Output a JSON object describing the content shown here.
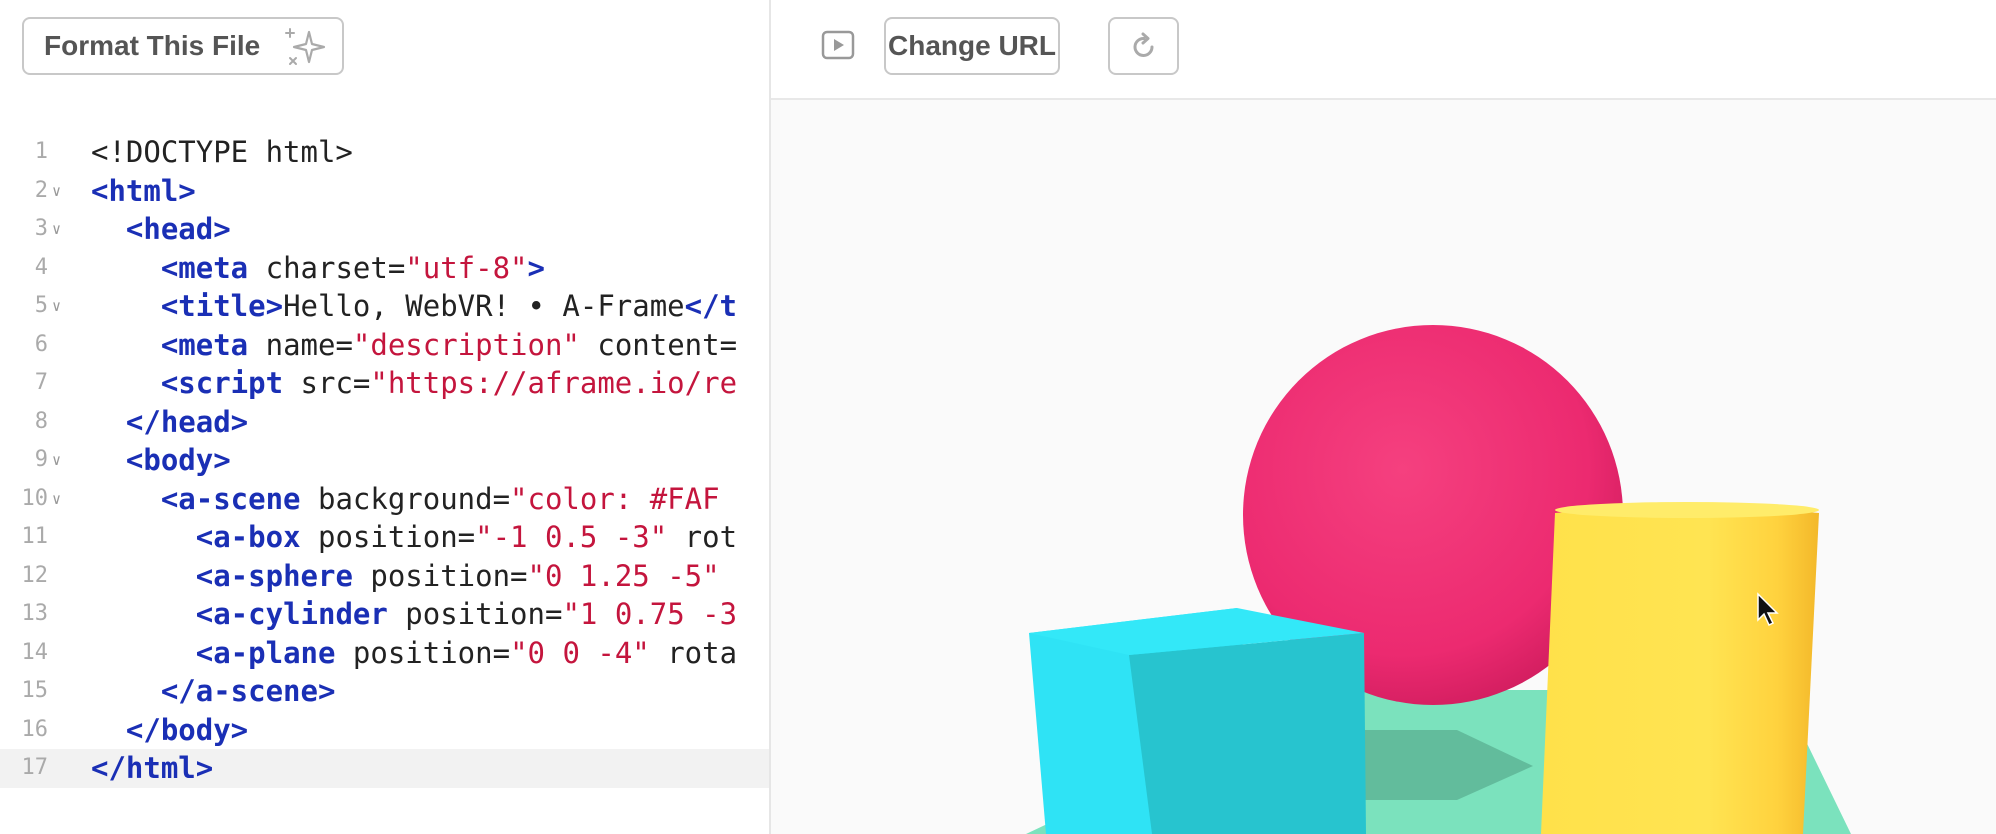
{
  "editor": {
    "format_button_label": "Format This File",
    "sparkle_icon": "sparkle-icon",
    "current_line": 17,
    "lines": [
      {
        "n": "1",
        "fold": false,
        "parts": [
          {
            "t": "<!DOCTYPE html>",
            "c": "plain"
          }
        ]
      },
      {
        "n": "2",
        "fold": true,
        "parts": [
          {
            "t": "<html>",
            "c": "tag"
          }
        ]
      },
      {
        "n": "3",
        "fold": true,
        "parts": [
          {
            "t": "  ",
            "c": "plain"
          },
          {
            "t": "<head>",
            "c": "tag"
          }
        ]
      },
      {
        "n": "4",
        "fold": false,
        "parts": [
          {
            "t": "    ",
            "c": "plain"
          },
          {
            "t": "<meta",
            "c": "tag"
          },
          {
            "t": " charset=",
            "c": "plain"
          },
          {
            "t": "\"utf-8\"",
            "c": "str"
          },
          {
            "t": ">",
            "c": "tag"
          }
        ]
      },
      {
        "n": "5",
        "fold": true,
        "parts": [
          {
            "t": "    ",
            "c": "plain"
          },
          {
            "t": "<title>",
            "c": "tag"
          },
          {
            "t": "Hello, WebVR! • A-Frame",
            "c": "plain"
          },
          {
            "t": "</t",
            "c": "tag"
          }
        ]
      },
      {
        "n": "6",
        "fold": false,
        "parts": [
          {
            "t": "    ",
            "c": "plain"
          },
          {
            "t": "<meta",
            "c": "tag"
          },
          {
            "t": " name=",
            "c": "plain"
          },
          {
            "t": "\"description\"",
            "c": "str"
          },
          {
            "t": " content=",
            "c": "plain"
          }
        ]
      },
      {
        "n": "7",
        "fold": false,
        "parts": [
          {
            "t": "    ",
            "c": "plain"
          },
          {
            "t": "<script",
            "c": "tag"
          },
          {
            "t": " src=",
            "c": "plain"
          },
          {
            "t": "\"https://aframe.io/re",
            "c": "str"
          }
        ]
      },
      {
        "n": "8",
        "fold": false,
        "parts": [
          {
            "t": "  ",
            "c": "plain"
          },
          {
            "t": "</head>",
            "c": "tag"
          }
        ]
      },
      {
        "n": "9",
        "fold": true,
        "parts": [
          {
            "t": "  ",
            "c": "plain"
          },
          {
            "t": "<body>",
            "c": "tag"
          }
        ]
      },
      {
        "n": "10",
        "fold": true,
        "parts": [
          {
            "t": "    ",
            "c": "plain"
          },
          {
            "t": "<a-scene",
            "c": "tag"
          },
          {
            "t": " background=",
            "c": "plain"
          },
          {
            "t": "\"color: #FAF",
            "c": "str"
          }
        ]
      },
      {
        "n": "11",
        "fold": false,
        "parts": [
          {
            "t": "      ",
            "c": "plain"
          },
          {
            "t": "<a-box",
            "c": "tag"
          },
          {
            "t": " position=",
            "c": "plain"
          },
          {
            "t": "\"-1 0.5 -3\"",
            "c": "str"
          },
          {
            "t": " rot",
            "c": "plain"
          }
        ]
      },
      {
        "n": "12",
        "fold": false,
        "parts": [
          {
            "t": "      ",
            "c": "plain"
          },
          {
            "t": "<a-sphere",
            "c": "tag"
          },
          {
            "t": " position=",
            "c": "plain"
          },
          {
            "t": "\"0 1.25 -5\"",
            "c": "str"
          }
        ]
      },
      {
        "n": "13",
        "fold": false,
        "parts": [
          {
            "t": "      ",
            "c": "plain"
          },
          {
            "t": "<a-cylinder",
            "c": "tag"
          },
          {
            "t": " position=",
            "c": "plain"
          },
          {
            "t": "\"1 0.75 -3",
            "c": "str"
          }
        ]
      },
      {
        "n": "14",
        "fold": false,
        "parts": [
          {
            "t": "      ",
            "c": "plain"
          },
          {
            "t": "<a-plane",
            "c": "tag"
          },
          {
            "t": " position=",
            "c": "plain"
          },
          {
            "t": "\"0 0 -4\"",
            "c": "str"
          },
          {
            "t": " rota",
            "c": "plain"
          }
        ]
      },
      {
        "n": "15",
        "fold": false,
        "parts": [
          {
            "t": "    ",
            "c": "plain"
          },
          {
            "t": "</a-scene>",
            "c": "tag"
          }
        ]
      },
      {
        "n": "16",
        "fold": false,
        "parts": [
          {
            "t": "  ",
            "c": "plain"
          },
          {
            "t": "</body>",
            "c": "tag"
          }
        ]
      },
      {
        "n": "17",
        "fold": false,
        "parts": [
          {
            "t": "</html>",
            "c": "tag"
          }
        ]
      }
    ]
  },
  "preview": {
    "play_icon": "play-icon",
    "change_url_label": "Change URL",
    "refresh_icon": "refresh-icon"
  },
  "colors": {
    "tag": "#1a2fb5",
    "string": "#c4153d",
    "sphere": "#ef2d74",
    "box": "#2fe3f5",
    "cylinder": "#ffe14d",
    "plane": "#7be2bd",
    "scene_background": "#fafafa"
  }
}
